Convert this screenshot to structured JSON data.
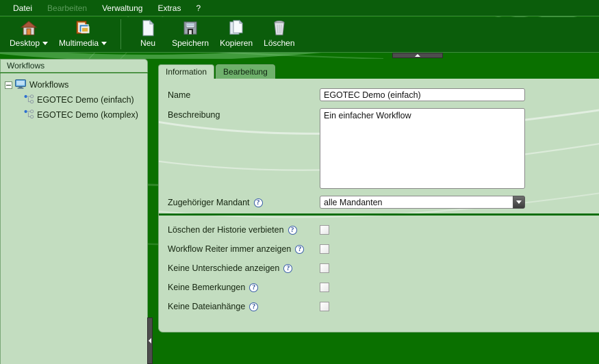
{
  "menu": {
    "items": [
      {
        "label": "Datei",
        "disabled": false
      },
      {
        "label": "Bearbeiten",
        "disabled": true
      },
      {
        "label": "Verwaltung",
        "disabled": false
      },
      {
        "label": "Extras",
        "disabled": false
      },
      {
        "label": "?",
        "disabled": false
      }
    ]
  },
  "toolbar": {
    "items": [
      {
        "label": "Desktop",
        "icon": "home-icon",
        "dropdown": true
      },
      {
        "label": "Multimedia",
        "icon": "multimedia-icon",
        "dropdown": true
      },
      {
        "label": "Neu",
        "icon": "new-document-icon",
        "dropdown": false
      },
      {
        "label": "Speichern",
        "icon": "save-floppy-icon",
        "dropdown": false
      },
      {
        "label": "Kopieren",
        "icon": "copy-icon",
        "dropdown": false
      },
      {
        "label": "Löschen",
        "icon": "trash-icon",
        "dropdown": false
      }
    ]
  },
  "sidebar": {
    "title": "Workflows",
    "root": {
      "label": "Workflows",
      "icon": "monitor-icon",
      "expanded": true
    },
    "children": [
      {
        "label": "EGOTEC Demo (einfach)",
        "icon": "workflow-node-icon"
      },
      {
        "label": "EGOTEC Demo (komplex)",
        "icon": "workflow-node-icon"
      }
    ]
  },
  "tabs": [
    {
      "label": "Information",
      "active": true
    },
    {
      "label": "Bearbeitung",
      "active": false
    }
  ],
  "form": {
    "name": {
      "label": "Name",
      "value": "EGOTEC Demo (einfach)",
      "placeholder": ""
    },
    "description": {
      "label": "Beschreibung",
      "value": "Ein einfacher Workflow",
      "placeholder": ""
    },
    "mandant": {
      "label": "Zugehöriger Mandant",
      "value": "alle Mandanten",
      "help": "?",
      "options": [
        "alle Mandanten"
      ]
    },
    "options": [
      {
        "label": "Löschen der Historie verbieten",
        "help": "?",
        "checked": false
      },
      {
        "label": "Workflow Reiter immer anzeigen",
        "help": "?",
        "checked": false
      },
      {
        "label": "Keine Unterschiede anzeigen",
        "help": "?",
        "checked": false
      },
      {
        "label": "Keine Bemerkungen",
        "help": "?",
        "checked": false
      },
      {
        "label": "Keine Dateianhänge",
        "help": "?",
        "checked": false
      }
    ]
  },
  "splitters": {
    "horizontal": {
      "name": "horizontal-splitter-handle",
      "arrow": "up"
    },
    "vertical": {
      "name": "vertical-splitter-handle",
      "arrow": "left"
    }
  },
  "colors": {
    "header_dark_green": "#0b5d0b",
    "body_green": "#0a7000",
    "panel_light_green": "#c3ddc0",
    "tab_inactive_green": "#6fb16c",
    "divider_green": "#0a6d0a",
    "help_blue": "#2a4d96"
  }
}
